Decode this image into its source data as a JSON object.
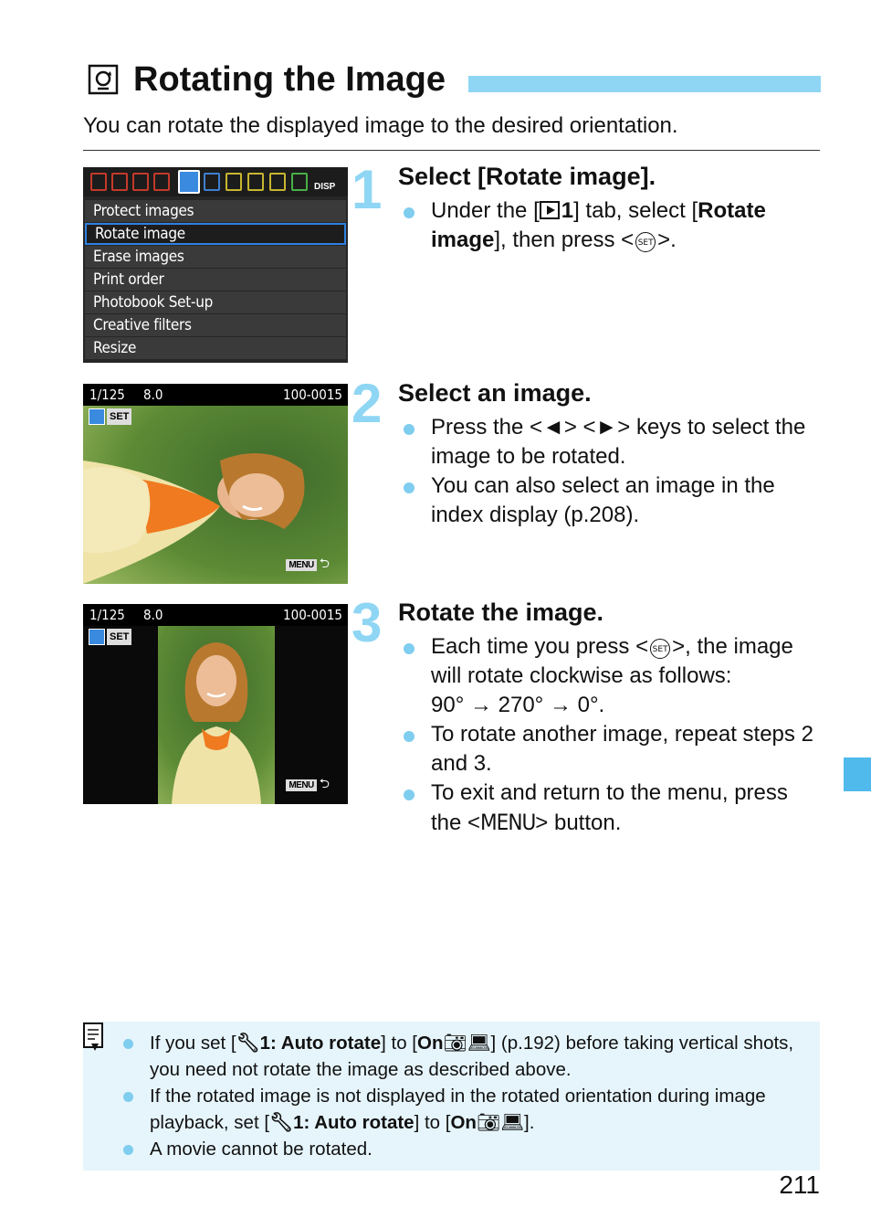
{
  "header": {
    "title": "Rotating the Image",
    "intro": "You can rotate the displayed image to the desired orientation."
  },
  "colors": {
    "accent": "#8fd6f4",
    "bullet": "#7fcdef",
    "note_bg": "#e6f5fc",
    "side_tab": "#4fbaeb"
  },
  "steps": [
    {
      "number": "1",
      "title": "Select [Rotate image].",
      "bullets": [
        {
          "pre": "Under the [",
          "tab_num": "1",
          "mid": "] tab, select [",
          "bold": "Rotate image",
          "post1": "], then press <",
          "post2": ">."
        }
      ],
      "screen": {
        "menu_items": [
          "Protect images",
          "Rotate image",
          "Erase images",
          "Print order",
          "Photobook Set-up",
          "Creative filters",
          "Resize"
        ],
        "selected_index": 1,
        "disp_badge": "DISP"
      }
    },
    {
      "number": "2",
      "title": "Select an image.",
      "bullets": [
        "Press the <◄> <►> keys to select the image to be rotated.",
        "You can also select an image in the index display (p.208)."
      ],
      "screen": {
        "shutter": "1/125",
        "aperture": "8.0",
        "file": "100-0015",
        "set_label": "SET",
        "menu_label": "MENU",
        "return_glyph": "⮌"
      }
    },
    {
      "number": "3",
      "title": "Rotate the image.",
      "bullets": [
        {
          "pre": "Each time you press <",
          "post": ">, the image will rotate clockwise as follows:",
          "sequence": "90° → 270° → 0°."
        },
        "To rotate another image, repeat steps 2 and 3.",
        {
          "pre": "To exit and return to the menu, press the <",
          "menu_word": "MENU",
          "post": "> button."
        }
      ],
      "screen": {
        "shutter": "1/125",
        "aperture": "8.0",
        "file": "100-0015",
        "set_label": "SET",
        "menu_label": "MENU",
        "return_glyph": "⮌"
      }
    }
  ],
  "set_button_label": "SET",
  "note": {
    "items": [
      {
        "a": "If you set [",
        "b": "1: Auto rotate",
        "c": "] to [",
        "d": "On",
        "e": "] (p.192) before taking vertical shots, you need not rotate the image as described above."
      },
      {
        "a": "If the rotated image is not displayed in the rotated orientation during image playback, set [",
        "b": "1: Auto rotate",
        "c": "] to [",
        "d": "On",
        "e": "]."
      },
      {
        "text": "A movie cannot be rotated."
      }
    ]
  },
  "page_number": "211"
}
